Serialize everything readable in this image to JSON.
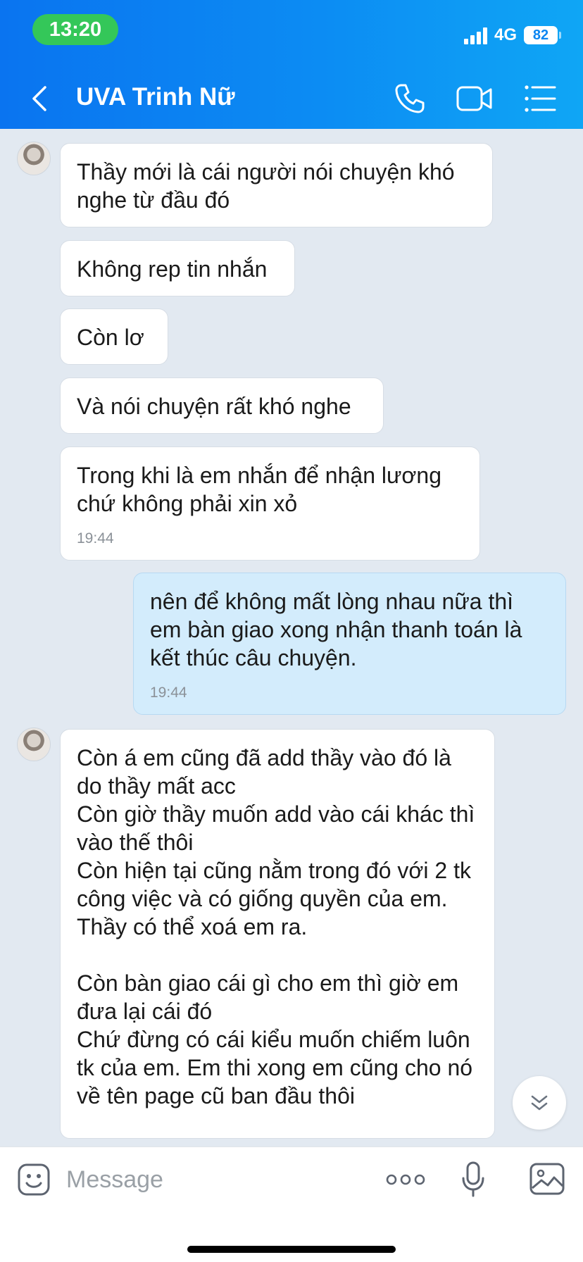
{
  "status_bar": {
    "time": "13:20",
    "network": "4G",
    "battery": "82"
  },
  "header": {
    "title": "UVA Trinh Nữ",
    "icons": {
      "back": "back-chevron-icon",
      "call": "phone-icon",
      "video": "video-camera-icon",
      "menu": "list-menu-icon"
    }
  },
  "messages": [
    {
      "direction": "incoming",
      "text": "Thầy mới là cái người nói chuyện khó nghe từ đầu đó"
    },
    {
      "direction": "incoming",
      "text": "Không rep tin nhắn"
    },
    {
      "direction": "incoming",
      "text": "Còn lơ"
    },
    {
      "direction": "incoming",
      "text": "Và nói chuyện rất khó nghe"
    },
    {
      "direction": "incoming",
      "text": "Trong khi là em nhắn để nhận lương chứ không phải xin xỏ",
      "time": "19:44"
    },
    {
      "direction": "outgoing",
      "text": "nên để không mất lòng nhau nữa thì em bàn giao xong nhận thanh toán là kết thúc câu chuyện.",
      "time": "19:44"
    },
    {
      "direction": "incoming",
      "text": "Còn á em cũng đã add thầy vào đó là do thầy mất acc\nCòn giờ thầy muốn add vào cái khác thì vào thế thôi\nCòn hiện tại cũng nằm trong đó với 2 tk công việc và có giống quyền của em.\nThầy có thể xoá em ra.\n\nCòn bàn giao cái gì cho em thì giờ em đưa lại cái đó\nChứ đừng có cái kiểu muốn chiếm luôn tk của em. Em thi xong em cũng cho nó về tên page cũ ban đầu thôi"
    }
  ],
  "input_bar": {
    "placeholder": "Message"
  },
  "colors": {
    "header_start": "#0a74f0",
    "header_end": "#0fa6f5",
    "outgoing_bubble": "#d3ecfc",
    "chat_background": "#e2e9f1"
  }
}
